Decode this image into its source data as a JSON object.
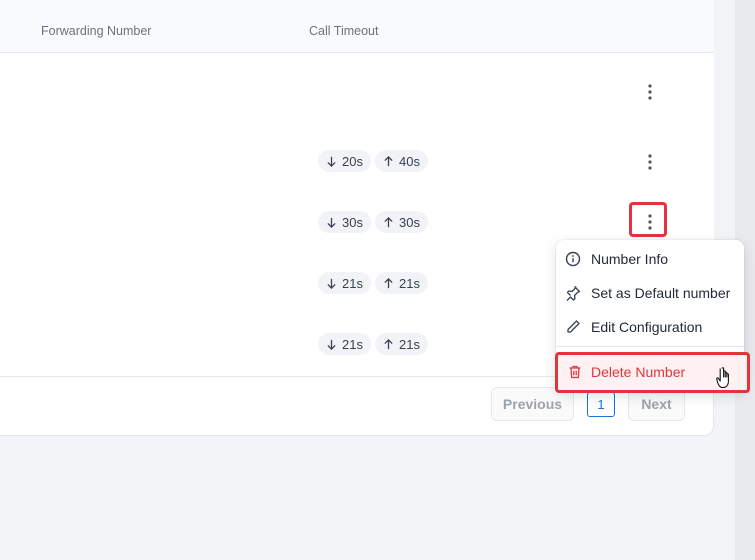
{
  "table": {
    "columns": [
      "Forwarding Number",
      "Call Timeout"
    ],
    "rows": [
      {
        "timeout_in": "",
        "timeout_out": ""
      },
      {
        "timeout_in": "20s",
        "timeout_out": "40s"
      },
      {
        "timeout_in": "30s",
        "timeout_out": "30s"
      },
      {
        "timeout_in": "21s",
        "timeout_out": "21s"
      },
      {
        "timeout_in": "21s",
        "timeout_out": "21s"
      }
    ]
  },
  "actions_menu": {
    "items": [
      {
        "label": "Number Info",
        "icon": "info-icon"
      },
      {
        "label": "Set as Default number",
        "icon": "pin-icon"
      },
      {
        "label": "Edit Configuration",
        "icon": "pencil-icon"
      },
      {
        "label": "Delete Number",
        "icon": "trash-icon"
      }
    ]
  },
  "pagination": {
    "previous_label": "Previous",
    "current_page": "1",
    "next_label": "Next"
  },
  "colors": {
    "accent": "#1d6fd8",
    "danger": "#e0353b",
    "highlight": "#e0353b"
  }
}
